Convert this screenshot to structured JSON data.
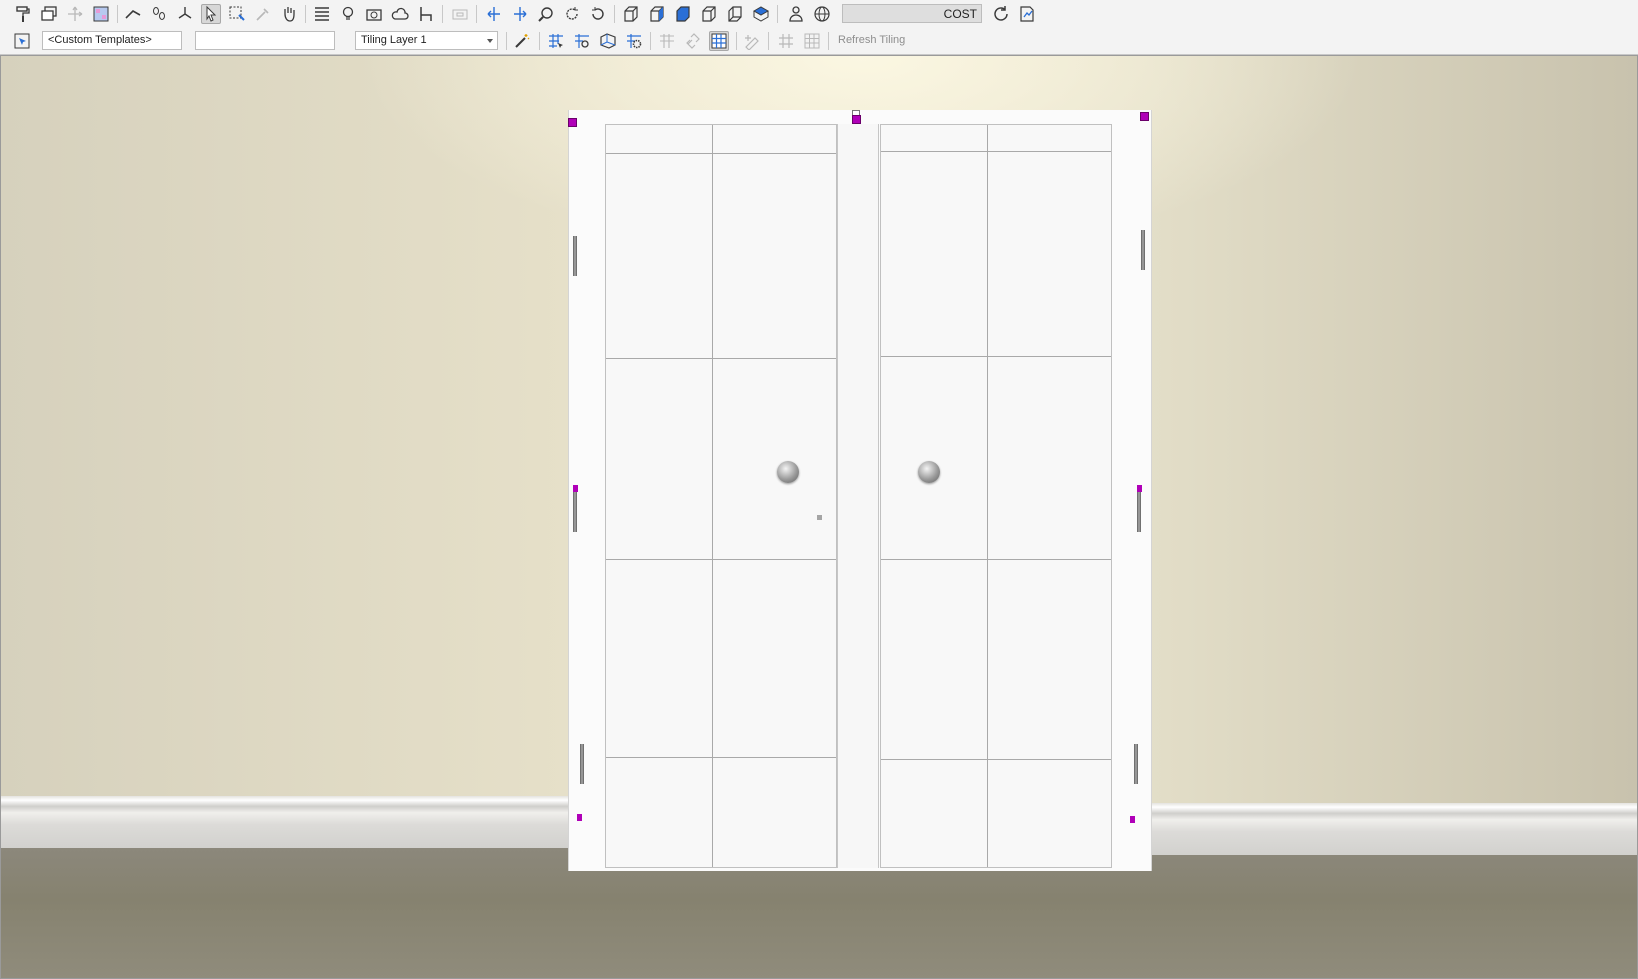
{
  "toolbar_top": {
    "icons": [
      "paint-roller-icon",
      "layers-icon",
      "move-arrows-icon",
      "grid-tile-icon",
      "roof-icon",
      "footprints-icon",
      "axis-icon",
      "pointer-icon",
      "marquee-select-icon",
      "eyedropper-icon",
      "hand-pan-icon",
      "list-icon",
      "lightbulb-icon",
      "camera-icon",
      "cloud-icon",
      "chair-icon",
      "frame-icon",
      "walk-left-icon",
      "walk-right-icon",
      "zoom-icon",
      "rotate-cw-icon",
      "rotate-ccw-icon",
      "cube-front-icon",
      "cube-side-icon",
      "cube-filled-icon",
      "cube-open-icon",
      "cube-back-icon",
      "cube-top-icon",
      "person-icon",
      "globe-icon",
      "refresh-icon",
      "report-icon"
    ],
    "cost_label": "COST"
  },
  "toolbar_second": {
    "template_value": "<Custom Templates>",
    "second_field_value": "",
    "tiling_layer_value": "Tiling Layer 1",
    "refresh_tiling_label": "Refresh Tiling",
    "icons": [
      "magic-wand-icon",
      "tile-select-icon",
      "tile-zoom-icon",
      "tile-3d-icon",
      "tile-settings-icon",
      "tile-add-icon",
      "tile-link-icon",
      "tile-grid-icon",
      "tile-edit-icon",
      "tile-pattern-icon",
      "tile-table-icon"
    ]
  },
  "colors": {
    "selection_handle": "#b000b8",
    "toolbar_bg": "#f3f3f3"
  }
}
